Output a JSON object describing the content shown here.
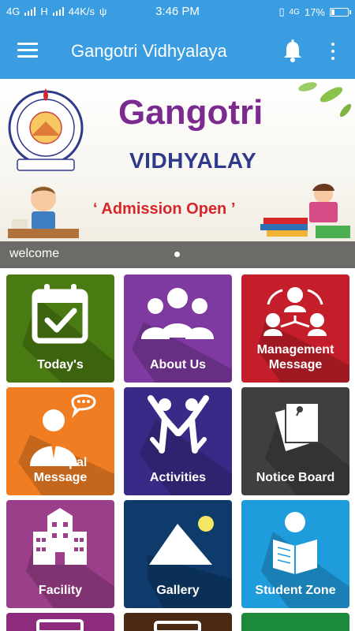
{
  "status": {
    "left": [
      "4G",
      "H",
      "44K/s"
    ],
    "time": "3:46 PM",
    "battery": "17%"
  },
  "appbar": {
    "title": "Gangotri Vidhyalaya",
    "icons": [
      "menu-icon",
      "bell-icon",
      "more-vert-icon"
    ]
  },
  "banner": {
    "brand": "Gangotri",
    "subtitle": "VIDHYALAY",
    "admission": "‘ Admission Open ’",
    "caption": "welcome"
  },
  "tiles": [
    {
      "label": "Today's",
      "color": "#4a7a12",
      "icon": "calendar-check-icon"
    },
    {
      "label": "About Us",
      "color": "#7e3aa0",
      "icon": "group-icon"
    },
    {
      "label": "Management Message",
      "color": "#c41e2a",
      "icon": "org-chart-icon"
    },
    {
      "label": "Principal Message",
      "color": "#f07d22",
      "icon": "principal-icon"
    },
    {
      "label": "Activities",
      "color": "#3a2a87",
      "icon": "activities-icon"
    },
    {
      "label": "Notice Board",
      "color": "#3f3f3f",
      "icon": "notice-icon"
    },
    {
      "label": "Facility",
      "color": "#9b3f8a",
      "icon": "building-icon"
    },
    {
      "label": "Gallery",
      "color": "#0e3b6b",
      "icon": "image-icon"
    },
    {
      "label": "Student Zone",
      "color": "#1f9cdc",
      "icon": "reader-icon"
    },
    {
      "label": "",
      "color": "#8d2b7c",
      "icon": "more-tile"
    },
    {
      "label": "",
      "color": "#4a2a14",
      "icon": "more-tile"
    },
    {
      "label": "",
      "color": "#1b8a3a",
      "icon": "more-tile"
    }
  ]
}
